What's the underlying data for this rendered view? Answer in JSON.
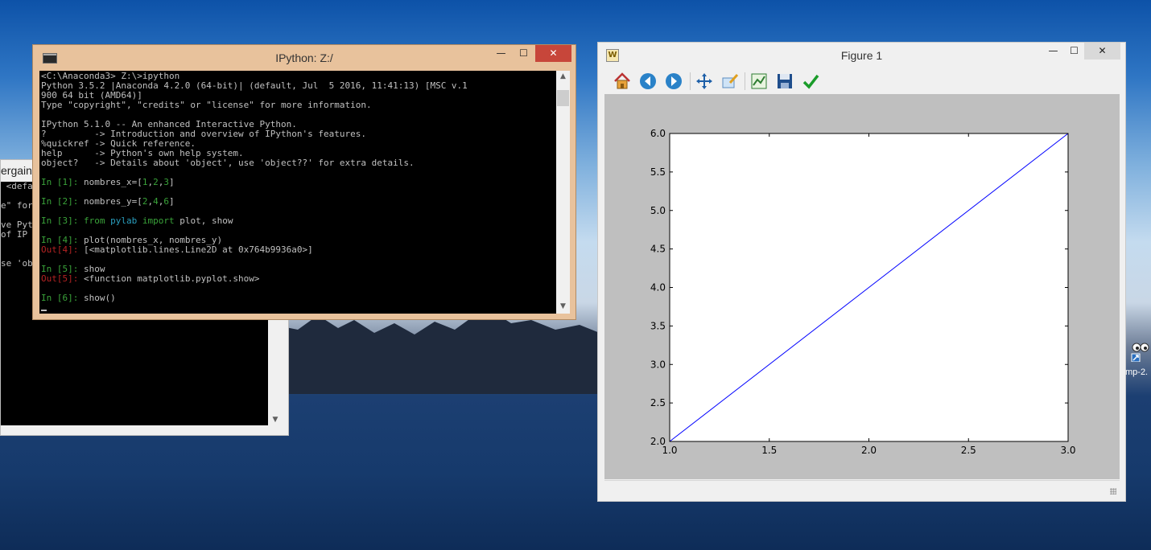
{
  "back_console": {
    "title_fragment": "ergain",
    "lines": [
      " <defa",
      "",
      "e\" for",
      "",
      "ve Pyt",
      "of IP",
      "",
      "",
      "se 'ob"
    ]
  },
  "ipython_window": {
    "title": "IPython: Z:/",
    "controls": {
      "minimize": "—",
      "maximize": "☐",
      "close": "✕"
    },
    "console_lines": [
      [
        {
          "t": "<C:\\Anaconda3> Z:\\>ipython",
          "c": ""
        }
      ],
      [
        {
          "t": "Python 3.5.2 |Anaconda 4.2.0 (64-bit)| (default, Jul  5 2016, 11:41:13) [MSC v.1",
          "c": ""
        }
      ],
      [
        {
          "t": "900 64 bit (AMD64)]",
          "c": ""
        }
      ],
      [
        {
          "t": "Type \"copyright\", \"credits\" or \"license\" for more information.",
          "c": ""
        }
      ],
      [
        {
          "t": "",
          "c": ""
        }
      ],
      [
        {
          "t": "IPython 5.1.0 -- An enhanced Interactive Python.",
          "c": ""
        }
      ],
      [
        {
          "t": "?         -> Introduction and overview of IPython's features.",
          "c": ""
        }
      ],
      [
        {
          "t": "%quickref -> Quick reference.",
          "c": ""
        }
      ],
      [
        {
          "t": "help      -> Python's own help system.",
          "c": ""
        }
      ],
      [
        {
          "t": "object?   -> Details about 'object', use 'object??' for extra details.",
          "c": ""
        }
      ],
      [
        {
          "t": "",
          "c": ""
        }
      ],
      [
        {
          "t": "In [1]: ",
          "c": "cg"
        },
        {
          "t": "nombres_x=[",
          "c": ""
        },
        {
          "t": "1",
          "c": "cn"
        },
        {
          "t": ",",
          "c": ""
        },
        {
          "t": "2",
          "c": "cn"
        },
        {
          "t": ",",
          "c": ""
        },
        {
          "t": "3",
          "c": "cn"
        },
        {
          "t": "]",
          "c": ""
        }
      ],
      [
        {
          "t": "",
          "c": ""
        }
      ],
      [
        {
          "t": "In [2]: ",
          "c": "cg"
        },
        {
          "t": "nombres_y=[",
          "c": ""
        },
        {
          "t": "2",
          "c": "cn"
        },
        {
          "t": ",",
          "c": ""
        },
        {
          "t": "4",
          "c": "cn"
        },
        {
          "t": ",",
          "c": ""
        },
        {
          "t": "6",
          "c": "cn"
        },
        {
          "t": "]",
          "c": ""
        }
      ],
      [
        {
          "t": "",
          "c": ""
        }
      ],
      [
        {
          "t": "In [3]: ",
          "c": "cg"
        },
        {
          "t": "from",
          "c": "cg"
        },
        {
          "t": " ",
          "c": ""
        },
        {
          "t": "pylab",
          "c": "cb"
        },
        {
          "t": " ",
          "c": ""
        },
        {
          "t": "import",
          "c": "cg"
        },
        {
          "t": " plot, show",
          "c": ""
        }
      ],
      [
        {
          "t": "",
          "c": ""
        }
      ],
      [
        {
          "t": "In [4]: ",
          "c": "cg"
        },
        {
          "t": "plot(nombres_x, nombres_y)",
          "c": ""
        }
      ],
      [
        {
          "t": "Out[4]: ",
          "c": "cr"
        },
        {
          "t": "[<matplotlib.lines.Line2D at 0x764b9936a0>]",
          "c": ""
        }
      ],
      [
        {
          "t": "",
          "c": ""
        }
      ],
      [
        {
          "t": "In [5]: ",
          "c": "cg"
        },
        {
          "t": "show",
          "c": ""
        }
      ],
      [
        {
          "t": "Out[5]: ",
          "c": "cr"
        },
        {
          "t": "<function matplotlib.pyplot.show>",
          "c": ""
        }
      ],
      [
        {
          "t": "",
          "c": ""
        }
      ],
      [
        {
          "t": "In [6]: ",
          "c": "cg"
        },
        {
          "t": "show()",
          "c": ""
        }
      ]
    ]
  },
  "figure_window": {
    "title": "Figure 1",
    "controls": {
      "minimize": "—",
      "maximize": "☐",
      "close": "✕"
    },
    "toolbar_icons": [
      "home-icon",
      "back-arrow-icon",
      "forward-arrow-icon",
      "pan-icon",
      "zoom-icon",
      "subplots-icon",
      "save-icon",
      "edit-check-icon"
    ]
  },
  "chart_data": {
    "type": "line",
    "x": [
      1,
      2,
      3
    ],
    "series": [
      {
        "values": [
          2,
          4,
          6
        ],
        "color": "#0000ff"
      }
    ],
    "xlim": [
      1.0,
      3.0
    ],
    "ylim": [
      2.0,
      6.0
    ],
    "xticks": [
      "1.0",
      "1.5",
      "2.0",
      "2.5",
      "3.0"
    ],
    "yticks": [
      "2.0",
      "2.5",
      "3.0",
      "3.5",
      "4.0",
      "4.5",
      "5.0",
      "5.5",
      "6.0"
    ],
    "xtick_values": [
      1.0,
      1.5,
      2.0,
      2.5,
      3.0
    ],
    "ytick_values": [
      2.0,
      2.5,
      3.0,
      3.5,
      4.0,
      4.5,
      5.0,
      5.5,
      6.0
    ],
    "grid": false
  },
  "desktop_icon": {
    "label": "mp-2."
  }
}
